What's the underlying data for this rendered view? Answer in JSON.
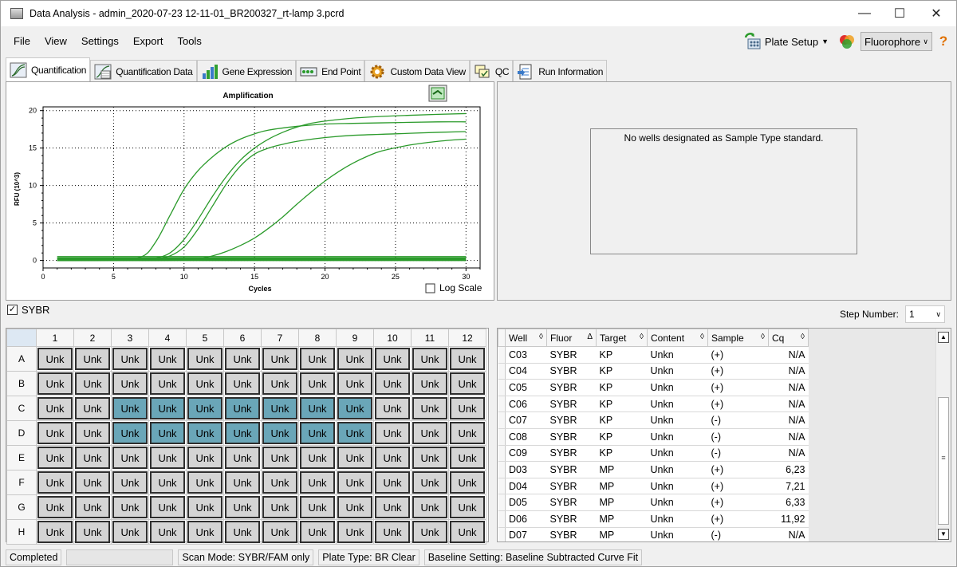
{
  "window": {
    "title": "Data Analysis - admin_2020-07-23 12-11-01_BR200327_rt-lamp 3.pcrd"
  },
  "menu": {
    "items": [
      "File",
      "View",
      "Settings",
      "Export",
      "Tools"
    ]
  },
  "toolbar": {
    "plate_setup": "Plate Setup",
    "fluorophore": "Fluorophore"
  },
  "tabs": [
    {
      "label": "Quantification",
      "icon": "amplification-icon",
      "active": true
    },
    {
      "label": "Quantification Data",
      "icon": "amplification-data-icon"
    },
    {
      "label": "Gene Expression",
      "icon": "bar-chart-icon"
    },
    {
      "label": "End Point",
      "icon": "endpoint-icon"
    },
    {
      "label": "Custom Data View",
      "icon": "gear-icon"
    },
    {
      "label": "QC",
      "icon": "qc-icon"
    },
    {
      "label": "Run Information",
      "icon": "run-info-icon"
    }
  ],
  "chart_data": {
    "type": "line",
    "title": "Amplification",
    "xlabel": "Cycles",
    "ylabel": "RFU (10^3)",
    "xlim": [
      0,
      31
    ],
    "ylim": [
      -1,
      20.5
    ],
    "xticks": [
      0,
      5,
      10,
      15,
      20,
      25,
      30
    ],
    "yticks": [
      0,
      5,
      10,
      15,
      20
    ],
    "grid": "dotted",
    "log_scale_label": "Log Scale",
    "log_scale": false,
    "series": [
      {
        "x": [
          1,
          5,
          7,
          8,
          9,
          10,
          11,
          12,
          13,
          14,
          15,
          16,
          18,
          20,
          22,
          25,
          28,
          30
        ],
        "y": [
          0.0,
          0.05,
          0.5,
          2.5,
          6.0,
          9.5,
          12.0,
          13.8,
          15.2,
          16.2,
          16.9,
          17.4,
          17.9,
          18.2,
          18.3,
          18.4,
          18.5,
          18.5
        ]
      },
      {
        "x": [
          1,
          5,
          7,
          8,
          9,
          10,
          11,
          12,
          13,
          14,
          15,
          16,
          17,
          18,
          19,
          20,
          22,
          25,
          28,
          30
        ],
        "y": [
          0.0,
          0.05,
          0.1,
          0.3,
          1.0,
          2.8,
          5.5,
          8.5,
          11.2,
          13.4,
          15.0,
          16.2,
          17.1,
          17.8,
          18.3,
          18.6,
          19.0,
          19.3,
          19.5,
          19.6
        ]
      },
      {
        "x": [
          1,
          5,
          7,
          8,
          9,
          10,
          11,
          12,
          13,
          14,
          15,
          16,
          17,
          18,
          20,
          22,
          25,
          28,
          30
        ],
        "y": [
          0.0,
          0.05,
          0.1,
          0.2,
          0.6,
          1.8,
          4.2,
          7.2,
          10.2,
          12.6,
          14.2,
          15.0,
          15.5,
          15.9,
          16.4,
          16.7,
          16.9,
          17.1,
          17.2
        ]
      },
      {
        "x": [
          1,
          5,
          8,
          10,
          11,
          12,
          13,
          14,
          15,
          16,
          17,
          18,
          19,
          20,
          21,
          22,
          23,
          24,
          26,
          28,
          30
        ],
        "y": [
          0.0,
          0.0,
          0.0,
          0.05,
          0.2,
          0.6,
          1.2,
          2.0,
          3.0,
          4.3,
          5.8,
          7.5,
          9.1,
          10.6,
          11.9,
          13.0,
          13.9,
          14.6,
          15.4,
          15.9,
          16.2
        ]
      },
      {
        "x": [
          1,
          30
        ],
        "y": [
          0.5,
          0.5
        ]
      },
      {
        "x": [
          1,
          30
        ],
        "y": [
          0.3,
          0.3
        ]
      },
      {
        "x": [
          1,
          30
        ],
        "y": [
          0.15,
          0.15
        ]
      },
      {
        "x": [
          1,
          30
        ],
        "y": [
          0.0,
          0.0
        ]
      }
    ]
  },
  "standard_message": "No wells designated as Sample Type standard.",
  "sybr": {
    "label": "SYBR",
    "checked": true
  },
  "step": {
    "label": "Step Number:",
    "value": "1"
  },
  "plate": {
    "columns": [
      "1",
      "2",
      "3",
      "4",
      "5",
      "6",
      "7",
      "8",
      "9",
      "10",
      "11",
      "12"
    ],
    "rows": [
      "A",
      "B",
      "C",
      "D",
      "E",
      "F",
      "G",
      "H"
    ],
    "well_label": "Unk",
    "selected": {
      "C": [
        3,
        4,
        5,
        6,
        7,
        8,
        9
      ],
      "D": [
        3,
        4,
        5,
        6,
        7,
        8,
        9
      ]
    }
  },
  "results": {
    "headers": [
      "Well",
      "Fluor",
      "Target",
      "Content",
      "Sample",
      "Cq"
    ],
    "rows": [
      [
        "C03",
        "SYBR",
        "KP",
        "Unkn",
        "(+)",
        "N/A"
      ],
      [
        "C04",
        "SYBR",
        "KP",
        "Unkn",
        "(+)",
        "N/A"
      ],
      [
        "C05",
        "SYBR",
        "KP",
        "Unkn",
        "(+)",
        "N/A"
      ],
      [
        "C06",
        "SYBR",
        "KP",
        "Unkn",
        "(+)",
        "N/A"
      ],
      [
        "C07",
        "SYBR",
        "KP",
        "Unkn",
        "(-)",
        "N/A"
      ],
      [
        "C08",
        "SYBR",
        "KP",
        "Unkn",
        "(-)",
        "N/A"
      ],
      [
        "C09",
        "SYBR",
        "KP",
        "Unkn",
        "(-)",
        "N/A"
      ],
      [
        "D03",
        "SYBR",
        "MP",
        "Unkn",
        "(+)",
        "6,23"
      ],
      [
        "D04",
        "SYBR",
        "MP",
        "Unkn",
        "(+)",
        "7,21"
      ],
      [
        "D05",
        "SYBR",
        "MP",
        "Unkn",
        "(+)",
        "6,33"
      ],
      [
        "D06",
        "SYBR",
        "MP",
        "Unkn",
        "(+)",
        "11,92"
      ],
      [
        "D07",
        "SYBR",
        "MP",
        "Unkn",
        "(-)",
        "N/A"
      ]
    ]
  },
  "status": {
    "state": "Completed",
    "scan_mode": "Scan Mode: SYBR/FAM only",
    "plate_type": "Plate Type: BR Clear",
    "baseline": "Baseline Setting: Baseline Subtracted Curve Fit"
  },
  "colors": {
    "curve": "#2a9a2a",
    "selected_well": "#6aa6b8",
    "well": "#d4d4d4"
  }
}
